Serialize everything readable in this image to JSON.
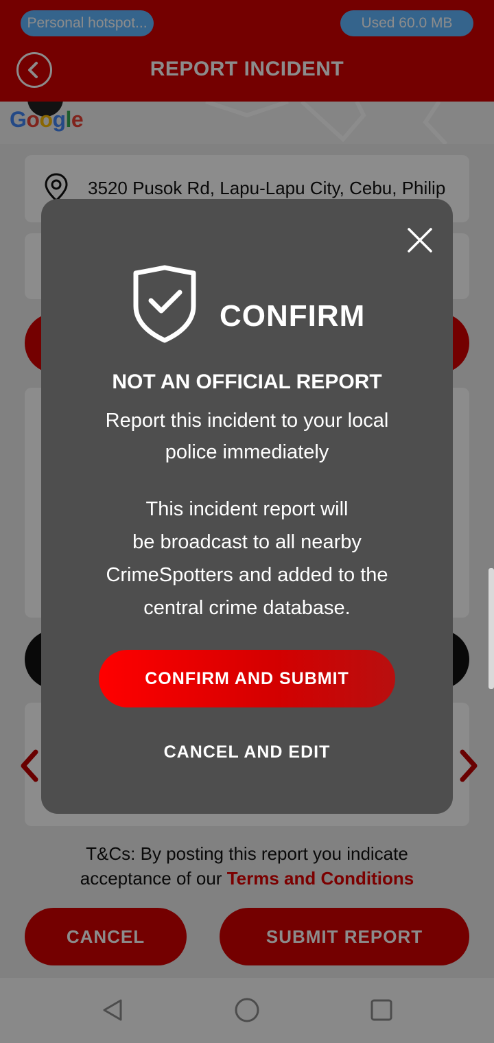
{
  "status_bar": {
    "hotspot_label": "Personal hotspot...",
    "data_used": "Used  60.0 MB"
  },
  "header": {
    "title": "REPORT INCIDENT",
    "back_icon": "back-arrow-icon"
  },
  "map": {
    "attribution": "Google"
  },
  "form": {
    "address": "3520 Pusok Rd, Lapu-Lapu City, Cebu, Philip",
    "terms_prefix": "T&Cs: By posting this report you indicate",
    "terms_middle": "acceptance of our ",
    "terms_link": "Terms and Conditions",
    "cancel_label": "CANCEL",
    "submit_label": "SUBMIT REPORT"
  },
  "dialog": {
    "title": "CONFIRM",
    "heading": "NOT AN OFFICIAL REPORT",
    "subtext_line1": "Report this incident to your local",
    "subtext_line2": "police immediately",
    "body_line1": "This incident report will",
    "body_line2": "be broadcast to all nearby",
    "body_line3": "CrimeSpotters and added to the",
    "body_line4": "central crime database.",
    "confirm_button": "CONFIRM AND SUBMIT",
    "cancel_button": "CANCEL AND EDIT"
  },
  "colors": {
    "brand_red": "#d40000",
    "dialog_bg": "#4e4e4e",
    "pill_blue": "#62b6ff"
  }
}
